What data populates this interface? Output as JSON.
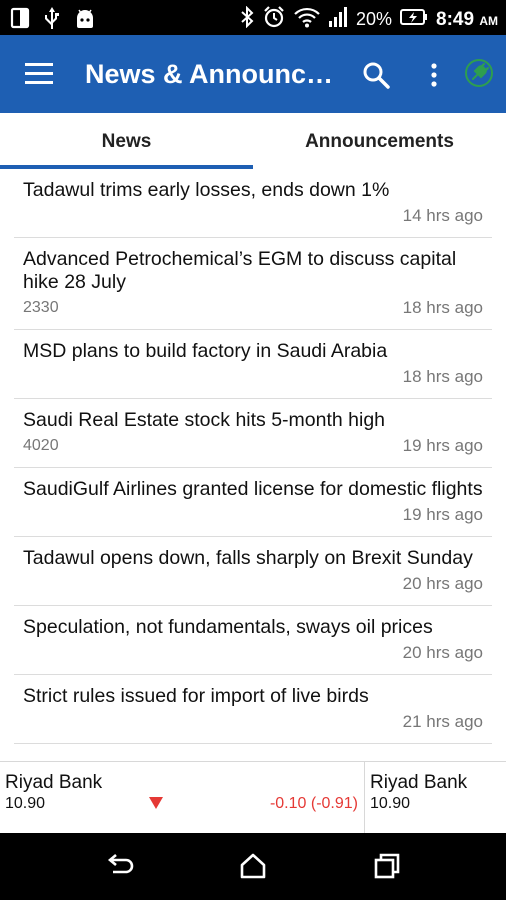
{
  "status_bar": {
    "battery": "20%",
    "time": "8:49",
    "ampm": "AM",
    "icons_left": [
      "screen-icon",
      "usb-icon",
      "android-icon"
    ],
    "icons_right": [
      "bluetooth-icon",
      "alarm-icon",
      "wifi-icon",
      "signal-icon",
      "battery-charging-icon"
    ]
  },
  "app_bar": {
    "title": "News & Announcements",
    "icons": [
      "menu-icon",
      "search-icon",
      "more-vert-icon",
      "plug-icon"
    ],
    "plug_color": "#2e9e4f"
  },
  "tabs": [
    {
      "label": "News",
      "selected": true
    },
    {
      "label": "Announcements",
      "selected": false
    }
  ],
  "news": [
    {
      "title": "Tadawul trims early losses, ends down 1%",
      "code": "",
      "time": "14 hrs ago"
    },
    {
      "title": "Advanced Petrochemical’s EGM to discuss capital hike 28 July",
      "code": "2330",
      "time": "18 hrs ago"
    },
    {
      "title": "MSD plans to build factory in Saudi Arabia",
      "code": "",
      "time": "18 hrs ago"
    },
    {
      "title": "Saudi Real Estate stock hits 5-month high",
      "code": "4020",
      "time": "19 hrs ago"
    },
    {
      "title": "SaudiGulf Airlines granted license for domestic flights",
      "code": "",
      "time": "19 hrs ago"
    },
    {
      "title": "Tadawul opens down, falls sharply on Brexit Sunday",
      "code": "",
      "time": "20 hrs ago"
    },
    {
      "title": "Speculation, not fundamentals, sways oil prices",
      "code": "",
      "time": "20 hrs ago"
    },
    {
      "title": "Strict rules issued for import of live birds",
      "code": "",
      "time": "21 hrs ago"
    }
  ],
  "ticker": {
    "main": {
      "name": "Riyad Bank",
      "price": "10.90",
      "change": "-0.10 (-0.91)",
      "direction": "down",
      "change_color": "#e53935"
    },
    "next": {
      "name": "Riyad Bank",
      "price": "10.90"
    }
  },
  "nav_bar": {
    "icons": [
      "back-icon",
      "home-icon",
      "recents-icon"
    ]
  },
  "colors": {
    "primary": "#1e5fb3",
    "negative": "#e53935"
  }
}
